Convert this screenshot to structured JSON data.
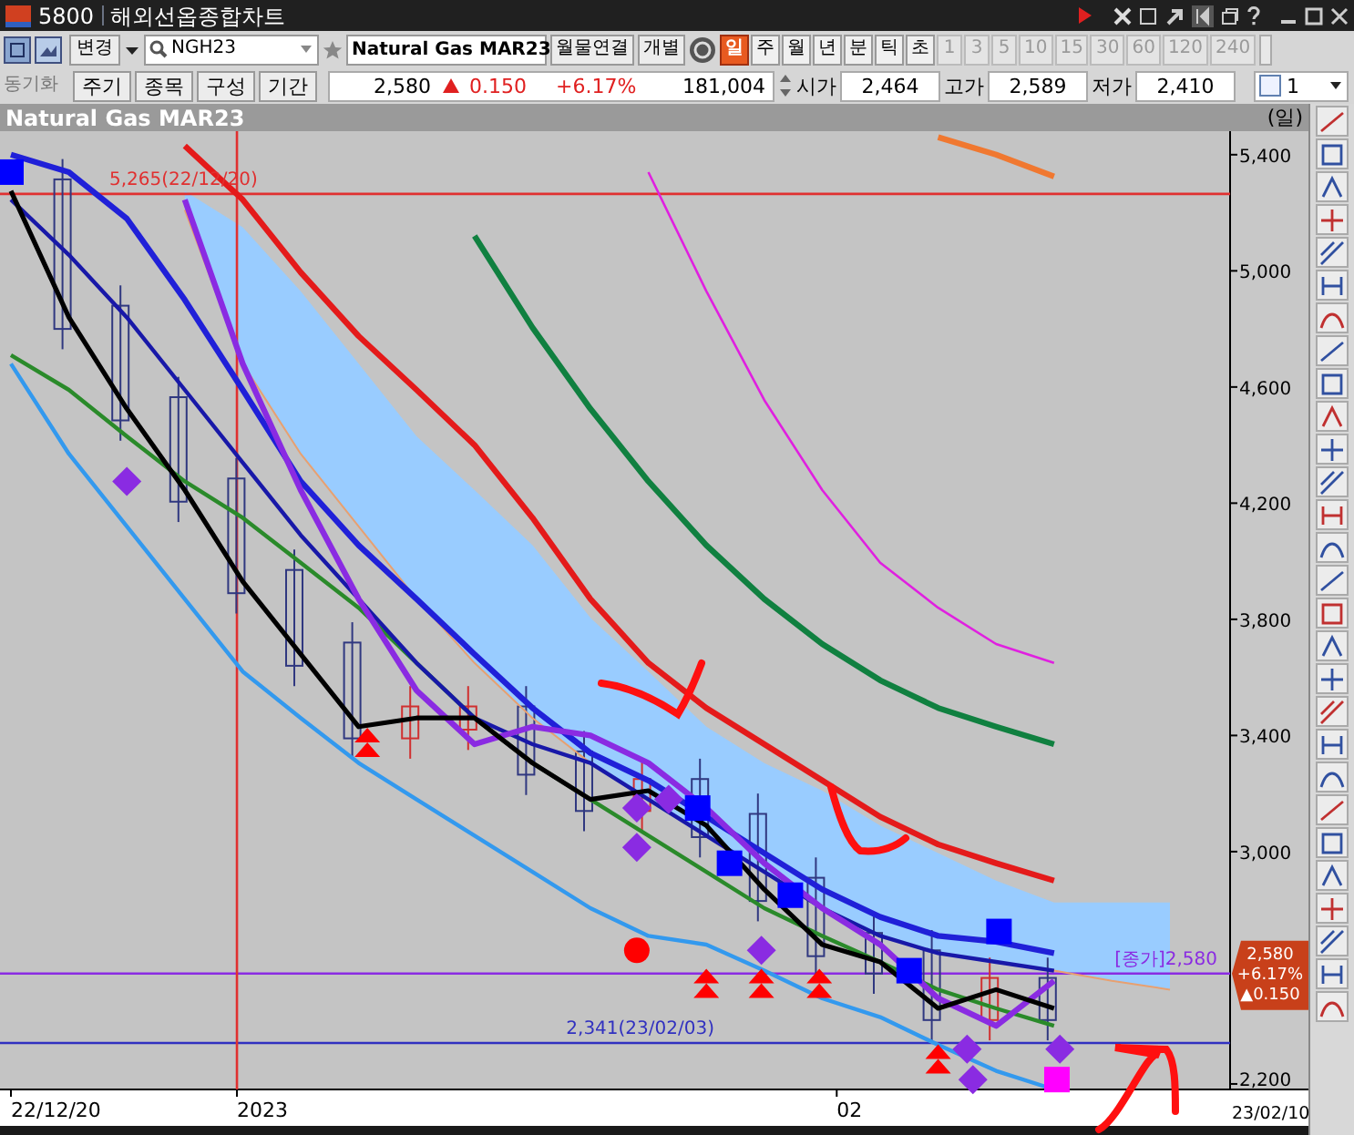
{
  "title_bar": {
    "screen_no": "5800",
    "title": "해외선옵종합차트"
  },
  "toolbar": {
    "change_button": "변경",
    "symbol_field": "NGH23",
    "symbol_name": "Natural Gas MAR23",
    "link_button": "월물연결",
    "individual_button": "개별",
    "periods": [
      {
        "label": "일",
        "selected": true,
        "disabled": false
      },
      {
        "label": "주",
        "selected": false,
        "disabled": false
      },
      {
        "label": "월",
        "selected": false,
        "disabled": false
      },
      {
        "label": "년",
        "selected": false,
        "disabled": false
      },
      {
        "label": "분",
        "selected": false,
        "disabled": false
      },
      {
        "label": "틱",
        "selected": false,
        "disabled": false
      },
      {
        "label": "초",
        "selected": false,
        "disabled": false
      },
      {
        "label": "1",
        "selected": false,
        "disabled": true
      },
      {
        "label": "3",
        "selected": false,
        "disabled": true
      },
      {
        "label": "5",
        "selected": false,
        "disabled": true
      },
      {
        "label": "10",
        "selected": false,
        "disabled": true
      },
      {
        "label": "15",
        "selected": false,
        "disabled": true
      },
      {
        "label": "30",
        "selected": false,
        "disabled": true
      },
      {
        "label": "60",
        "selected": false,
        "disabled": true
      },
      {
        "label": "120",
        "selected": false,
        "disabled": true
      },
      {
        "label": "240",
        "selected": false,
        "disabled": true
      }
    ]
  },
  "quote_bar": {
    "sync_label": "동기화",
    "buttons": [
      "주기",
      "종목",
      "구성",
      "기간"
    ],
    "price": "2,580",
    "change": "0.150",
    "change_pct": "+6.17%",
    "volume": "181,004",
    "open_label": "시가",
    "open": "2,464",
    "high_label": "고가",
    "high": "2,589",
    "low_label": "저가",
    "low": "2,410",
    "checked": false,
    "count": "1"
  },
  "chart": {
    "title": "Natural Gas MAR23",
    "period_label": "(일)",
    "y_axis_labels": [
      "5,400",
      "5,000",
      "4,600",
      "4,200",
      "3,800",
      "3,400",
      "3,000",
      "2,200"
    ],
    "x_axis_labels": [
      "22/12/20",
      "2023",
      "02"
    ],
    "end_date_label": "23/02/10",
    "reference_labels": [
      "5,265(22/12/20)",
      "[종가]2,580",
      "2,341(23/02/03)"
    ],
    "last_price_tag": {
      "price": "2,580",
      "change_pct": "+6.17%",
      "change": "▲0.150"
    }
  }
}
